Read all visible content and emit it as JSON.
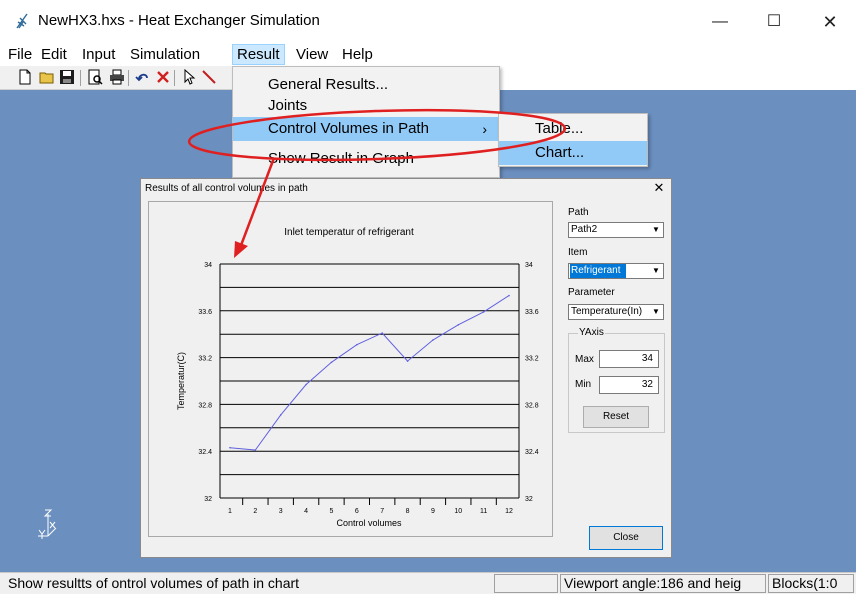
{
  "window": {
    "title": "NewHX3.hxs - Heat Exchanger Simulation",
    "minimize_glyph": "—",
    "maximize_glyph": "☐",
    "close_glyph": "✕"
  },
  "menubar": {
    "items": [
      {
        "label": "File"
      },
      {
        "label": "Edit"
      },
      {
        "label": "Input"
      },
      {
        "label": "Simulation"
      },
      {
        "label": "Result"
      },
      {
        "label": "View"
      },
      {
        "label": "Help"
      }
    ]
  },
  "toolbar": {
    "icons": [
      "new-file-icon",
      "open-folder-icon",
      "save-icon",
      "print-preview-icon",
      "print-icon",
      "undo-icon",
      "delete-icon",
      "select-pointer-icon",
      "draw-line-icon"
    ]
  },
  "result_menu": {
    "items": [
      {
        "label": "General Results..."
      },
      {
        "label": "Joints"
      },
      {
        "label": "Control Volumes in Path",
        "arrow": "›"
      },
      {
        "label": "Show Result in Graph"
      }
    ],
    "submenu": [
      {
        "label": "Table..."
      },
      {
        "label": "Chart..."
      }
    ]
  },
  "dialog": {
    "title": "Results of all control volumes in path",
    "close_glyph": "✕",
    "path_label": "Path",
    "path_value": "Path2",
    "item_label": "Item",
    "item_value": "Refrigerant",
    "parameter_label": "Parameter",
    "parameter_value": "Temperature(In)",
    "yaxis_group": "YAxis",
    "max_label": "Max",
    "max_value": "34",
    "min_label": "Min",
    "min_value": "32",
    "reset_label": "Reset",
    "close_label": "Close",
    "dropdown_glyph": "▼"
  },
  "chart_data": {
    "type": "line",
    "title": "Inlet temperatur of refrigerant",
    "xlabel": "Control volumes",
    "ylabel": "Temperatur(C)",
    "x": [
      1,
      2,
      3,
      4,
      5,
      6,
      7,
      8,
      9,
      10,
      11,
      12
    ],
    "series": [
      {
        "values": [
          32.43,
          32.41,
          32.71,
          32.97,
          33.16,
          33.31,
          33.41,
          33.17,
          33.35,
          33.48,
          33.59,
          33.73
        ]
      }
    ],
    "ylim": [
      32,
      34
    ],
    "yticks": [
      "32",
      "32.4",
      "32.8",
      "33.2",
      "33.6",
      "34"
    ],
    "xticks": [
      "1",
      "2",
      "3",
      "4",
      "5",
      "6",
      "7",
      "8",
      "9",
      "10",
      "11",
      "12"
    ],
    "grid": true,
    "line_color": "#6060e0"
  },
  "statusbar": {
    "message": "Show resultts of ontrol volumes of path in chart",
    "viewport": "Viewport angle:186 and heig",
    "blocks": "Blocks(1:0"
  },
  "annotation": {
    "color": "#e02020"
  },
  "colors": {
    "workspace": "#6b8fbf",
    "menu_highlight": "#91c9f7",
    "selection": "#0078d7"
  }
}
